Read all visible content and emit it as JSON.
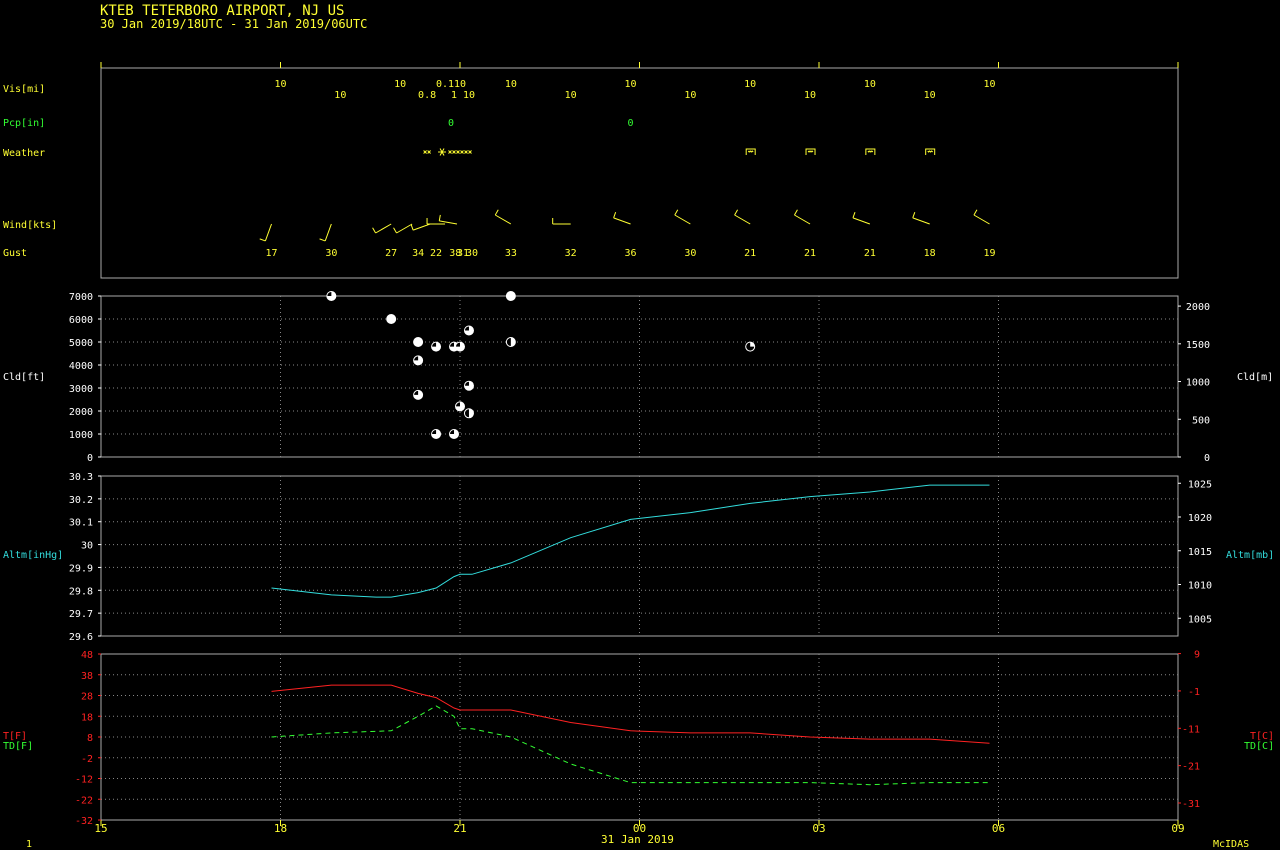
{
  "header": {
    "title": "KTEB  TETERBORO AIRPORT, NJ US",
    "period": "30 Jan 2019/18UTC - 31 Jan 2019/06UTC"
  },
  "footer": {
    "page": "1",
    "date": "31 Jan 2019",
    "brand": "McIDAS"
  },
  "colors": {
    "yellow": "#ffff33",
    "green": "#33ff33",
    "cyan": "#33dddd",
    "red": "#ff2222",
    "white": "#ffffff",
    "grid": "#888888",
    "frame": "#aaaaaa"
  },
  "time_axis": {
    "ticks": [
      "15",
      "18",
      "21",
      "00",
      "03",
      "06",
      "09"
    ],
    "range_hours": [
      15,
      33
    ]
  },
  "chart_data": [
    {
      "type": "table",
      "panel": "surface-observations",
      "rows": {
        "vis": {
          "label": "Vis[mi]",
          "obs": [
            {
              "t": 18.0,
              "v": "10"
            },
            {
              "t": 19.0,
              "v": "10"
            },
            {
              "t": 20.0,
              "v": "10"
            },
            {
              "t": 20.45,
              "v": "0.8"
            },
            {
              "t": 20.75,
              "v": "0.1"
            },
            {
              "t": 20.9,
              "v": "1"
            },
            {
              "t": 21.0,
              "v": "10"
            },
            {
              "t": 21.15,
              "v": "10"
            },
            {
              "t": 21.85,
              "v": "10"
            },
            {
              "t": 22.85,
              "v": "10"
            },
            {
              "t": 23.85,
              "v": "10"
            },
            {
              "t": 24.85,
              "v": "10"
            },
            {
              "t": 25.85,
              "v": "10"
            },
            {
              "t": 26.85,
              "v": "10"
            },
            {
              "t": 27.85,
              "v": "10"
            },
            {
              "t": 28.85,
              "v": "10"
            },
            {
              "t": 29.85,
              "v": "10"
            }
          ]
        },
        "pcp": {
          "label": "Pcp[in]",
          "obs": [
            {
              "t": 20.85,
              "v": "0"
            },
            {
              "t": 23.85,
              "v": "0"
            }
          ]
        },
        "weather": {
          "label": "Weather",
          "obs": [
            {
              "t": 20.45,
              "code": "snow-grains"
            },
            {
              "t": 20.7,
              "code": "snow-flake"
            },
            {
              "t": 21.0,
              "code": "snow-grains-series"
            },
            {
              "t": 25.85,
              "code": "fog-bracket"
            },
            {
              "t": 26.85,
              "code": "fog-bracket"
            },
            {
              "t": 27.85,
              "code": "fog-bracket"
            },
            {
              "t": 28.85,
              "code": "fog-bracket"
            }
          ]
        },
        "wind": {
          "label": "Wind[kts]",
          "obs": [
            {
              "t": 17.85,
              "dir": 200,
              "spd": 10
            },
            {
              "t": 18.85,
              "dir": 200,
              "spd": 10
            },
            {
              "t": 19.85,
              "dir": 240,
              "spd": 10
            },
            {
              "t": 20.2,
              "dir": 240,
              "spd": 10
            },
            {
              "t": 20.5,
              "dir": 250,
              "spd": 10
            },
            {
              "t": 20.75,
              "dir": 270,
              "spd": 10
            },
            {
              "t": 20.95,
              "dir": 280,
              "spd": 10
            },
            {
              "t": 21.85,
              "dir": 300,
              "spd": 10
            },
            {
              "t": 22.85,
              "dir": 270,
              "spd": 10
            },
            {
              "t": 23.85,
              "dir": 290,
              "spd": 10
            },
            {
              "t": 24.85,
              "dir": 300,
              "spd": 10
            },
            {
              "t": 25.85,
              "dir": 300,
              "spd": 10
            },
            {
              "t": 26.85,
              "dir": 300,
              "spd": 10
            },
            {
              "t": 27.85,
              "dir": 290,
              "spd": 10
            },
            {
              "t": 28.85,
              "dir": 290,
              "spd": 10
            },
            {
              "t": 29.85,
              "dir": 300,
              "spd": 10
            }
          ]
        },
        "gust": {
          "label": "Gust",
          "obs": [
            {
              "t": 17.85,
              "v": "17"
            },
            {
              "t": 18.85,
              "v": "30"
            },
            {
              "t": 19.85,
              "v": "27"
            },
            {
              "t": 20.3,
              "v": "34"
            },
            {
              "t": 20.6,
              "v": "22"
            },
            {
              "t": 20.92,
              "v": "38"
            },
            {
              "t": 21.05,
              "v": "31"
            },
            {
              "t": 21.2,
              "v": "30"
            },
            {
              "t": 21.85,
              "v": "33"
            },
            {
              "t": 22.85,
              "v": "32"
            },
            {
              "t": 23.85,
              "v": "36"
            },
            {
              "t": 24.85,
              "v": "30"
            },
            {
              "t": 25.85,
              "v": "21"
            },
            {
              "t": 26.85,
              "v": "21"
            },
            {
              "t": 27.85,
              "v": "21"
            },
            {
              "t": 28.85,
              "v": "18"
            },
            {
              "t": 29.85,
              "v": "19"
            }
          ]
        }
      }
    },
    {
      "type": "scatter",
      "panel": "cloud-height",
      "ylabel": "Cld[ft]",
      "ylabel_right": "Cld[m]",
      "ylim": [
        0,
        7000
      ],
      "yticks": [
        0,
        1000,
        2000,
        3000,
        4000,
        5000,
        6000,
        7000
      ],
      "yticks_right": [
        0,
        500,
        1000,
        1500,
        2000
      ],
      "points": [
        {
          "t": 18.85,
          "ft": 7000,
          "cover": "bkn"
        },
        {
          "t": 19.85,
          "ft": 6000,
          "cover": "ovc"
        },
        {
          "t": 20.3,
          "ft": 5000,
          "cover": "ovc"
        },
        {
          "t": 20.3,
          "ft": 4200,
          "cover": "bkn"
        },
        {
          "t": 20.3,
          "ft": 2700,
          "cover": "bkn"
        },
        {
          "t": 20.6,
          "ft": 4800,
          "cover": "bkn"
        },
        {
          "t": 20.6,
          "ft": 1000,
          "cover": "bkn"
        },
        {
          "t": 20.9,
          "ft": 4800,
          "cover": "bkn"
        },
        {
          "t": 20.9,
          "ft": 1000,
          "cover": "bkn"
        },
        {
          "t": 21.0,
          "ft": 4800,
          "cover": "bkn"
        },
        {
          "t": 21.0,
          "ft": 2200,
          "cover": "bkn"
        },
        {
          "t": 21.15,
          "ft": 5500,
          "cover": "bkn"
        },
        {
          "t": 21.15,
          "ft": 3100,
          "cover": "bkn"
        },
        {
          "t": 21.15,
          "ft": 1900,
          "cover": "sct"
        },
        {
          "t": 21.85,
          "ft": 7000,
          "cover": "ovc"
        },
        {
          "t": 21.85,
          "ft": 5000,
          "cover": "sct"
        },
        {
          "t": 25.85,
          "ft": 4800,
          "cover": "few"
        }
      ]
    },
    {
      "type": "line",
      "panel": "altimeter",
      "ylabel": "Altm[inHg]",
      "ylabel_right": "Altm[mb]",
      "ylim": [
        29.6,
        30.3
      ],
      "yticks": [
        29.6,
        29.7,
        29.8,
        29.9,
        30.0,
        30.1,
        30.2,
        30.3
      ],
      "yticks_right": [
        1005,
        1010,
        1015,
        1020,
        1025
      ],
      "series": [
        {
          "values": [
            [
              17.85,
              29.81
            ],
            [
              18.85,
              29.78
            ],
            [
              19.6,
              29.77
            ],
            [
              19.85,
              29.77
            ],
            [
              20.3,
              29.79
            ],
            [
              20.6,
              29.81
            ],
            [
              20.9,
              29.86
            ],
            [
              21.0,
              29.87
            ],
            [
              21.2,
              29.87
            ],
            [
              21.85,
              29.92
            ],
            [
              22.85,
              30.03
            ],
            [
              23.85,
              30.11
            ],
            [
              24.85,
              30.14
            ],
            [
              25.85,
              30.18
            ],
            [
              26.85,
              30.21
            ],
            [
              27.85,
              30.23
            ],
            [
              28.85,
              30.26
            ],
            [
              29.85,
              30.26
            ]
          ]
        }
      ]
    },
    {
      "type": "line",
      "panel": "temperature-dewpoint",
      "ylabel": "T[F]",
      "ylabel2": "TD[F]",
      "ylabel_right": "T[C]",
      "ylabel_right2": "TD[C]",
      "ylim": [
        -32,
        48
      ],
      "yticks": [
        -32,
        -22,
        -12,
        -2,
        8,
        18,
        28,
        38,
        48
      ],
      "yticks_right": [
        -31,
        -21,
        -11,
        -1,
        9
      ],
      "series": [
        {
          "key": "temp",
          "values": [
            [
              17.85,
              30
            ],
            [
              18.85,
              33
            ],
            [
              19.85,
              33
            ],
            [
              20.3,
              29
            ],
            [
              20.6,
              27
            ],
            [
              20.9,
              22
            ],
            [
              21.0,
              21
            ],
            [
              21.2,
              21
            ],
            [
              21.85,
              21
            ],
            [
              22.85,
              15
            ],
            [
              23.85,
              11
            ],
            [
              24.85,
              10
            ],
            [
              25.85,
              10
            ],
            [
              26.85,
              8
            ],
            [
              27.85,
              7
            ],
            [
              28.85,
              7
            ],
            [
              29.85,
              5
            ]
          ]
        },
        {
          "key": "dewpt",
          "values": [
            [
              17.85,
              8
            ],
            [
              18.85,
              10
            ],
            [
              19.85,
              11
            ],
            [
              20.3,
              18
            ],
            [
              20.6,
              23
            ],
            [
              20.9,
              18
            ],
            [
              21.0,
              12
            ],
            [
              21.2,
              12
            ],
            [
              21.85,
              8
            ],
            [
              22.85,
              -5
            ],
            [
              23.85,
              -14
            ],
            [
              24.85,
              -14
            ],
            [
              25.85,
              -14
            ],
            [
              26.85,
              -14
            ],
            [
              27.85,
              -15
            ],
            [
              28.85,
              -14
            ],
            [
              29.85,
              -14
            ]
          ]
        }
      ]
    }
  ]
}
